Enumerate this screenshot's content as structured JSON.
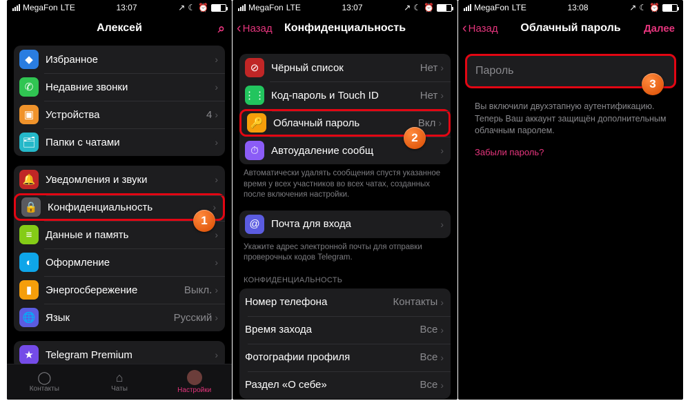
{
  "status": {
    "carrier": "MegaFon",
    "net": "LTE",
    "time1": "13:07",
    "time2": "13:07",
    "time3": "13:08"
  },
  "p1": {
    "title": "Алексей",
    "g1": [
      {
        "icon": "bookmark-icon",
        "label": "Избранное"
      },
      {
        "icon": "phone-icon",
        "label": "Недавние звонки"
      },
      {
        "icon": "devices-icon",
        "label": "Устройства",
        "value": "4"
      },
      {
        "icon": "folder-icon",
        "label": "Папки с чатами"
      }
    ],
    "g2": [
      {
        "icon": "bell-icon",
        "label": "Уведомления и звуки"
      },
      {
        "icon": "lock-icon",
        "label": "Конфиденциальность",
        "hl": true
      },
      {
        "icon": "data-icon",
        "label": "Данные и память"
      },
      {
        "icon": "appearance-icon",
        "label": "Оформление"
      },
      {
        "icon": "battery-icon",
        "label": "Энергосбережение",
        "value": "Выкл."
      },
      {
        "icon": "globe-icon",
        "label": "Язык",
        "value": "Русский"
      }
    ],
    "g3": [
      {
        "icon": "star-icon",
        "label": "Telegram Premium"
      }
    ],
    "tabs": {
      "contacts": "Контакты",
      "chats": "Чаты",
      "settings": "Настройки"
    }
  },
  "p2": {
    "back": "Назад",
    "title": "Конфиденциальность",
    "g1": [
      {
        "icon": "block-icon",
        "label": "Чёрный список",
        "value": "Нет"
      },
      {
        "icon": "passcode-icon",
        "label": "Код-пароль и Touch ID",
        "value": "Нет"
      },
      {
        "icon": "cloud-password-icon",
        "label": "Облачный пароль",
        "value": "Вкл",
        "hl": true
      },
      {
        "icon": "timer-icon",
        "label": "Автоудаление сообщ",
        "value": ""
      }
    ],
    "note1": "Автоматически удалять сообщения спустя указанное время у всех участников во всех чатах, созданных после включения настройки.",
    "g2": [
      {
        "icon": "mail-icon",
        "label": "Почта для входа"
      }
    ],
    "note2": "Укажите адрес электронной почты для отправки проверочных кодов Telegram.",
    "sect": "КОНФИДЕНЦИАЛЬНОСТЬ",
    "g3": [
      {
        "label": "Номер телефона",
        "value": "Контакты"
      },
      {
        "label": "Время захода",
        "value": "Все"
      },
      {
        "label": "Фотографии профиля",
        "value": "Все"
      },
      {
        "label": "Раздел «О себе»",
        "value": "Все"
      }
    ]
  },
  "p3": {
    "back": "Назад",
    "title": "Облачный пароль",
    "next": "Далее",
    "placeholder": "Пароль",
    "desc": "Вы включили двухэтапную аутентификацию. Теперь Ваш аккаунт защищён дополнительным облачным паролем.",
    "forgot": "Забыли пароль?"
  },
  "badges": {
    "b1": "1",
    "b2": "2",
    "b3": "3"
  },
  "glyph": {
    "bookmark-icon": "◆",
    "phone-icon": "✆",
    "devices-icon": "▣",
    "folder-icon": "🗂",
    "bell-icon": "🔔",
    "lock-icon": "🔒",
    "data-icon": "≡",
    "appearance-icon": "◐",
    "battery-icon": "▮",
    "globe-icon": "🌐",
    "star-icon": "★",
    "block-icon": "⊘",
    "passcode-icon": "⋮⋮",
    "cloud-password-icon": "🔑",
    "timer-icon": "⏱",
    "mail-icon": "@"
  },
  "iconbg": {
    "bookmark-icon": "bg-blue",
    "phone-icon": "bg-green",
    "devices-icon": "bg-orange",
    "folder-icon": "bg-teal",
    "bell-icon": "bg-darkred",
    "lock-icon": "bg-gray",
    "data-icon": "bg-lime",
    "appearance-icon": "bg-sky",
    "battery-icon": "bg-amber",
    "globe-icon": "bg-indigo",
    "star-icon": "bg-violet",
    "block-icon": "bg-darkred",
    "passcode-icon": "bg-greend",
    "cloud-password-icon": "bg-key",
    "timer-icon": "bg-purple",
    "mail-icon": "bg-indigo"
  }
}
